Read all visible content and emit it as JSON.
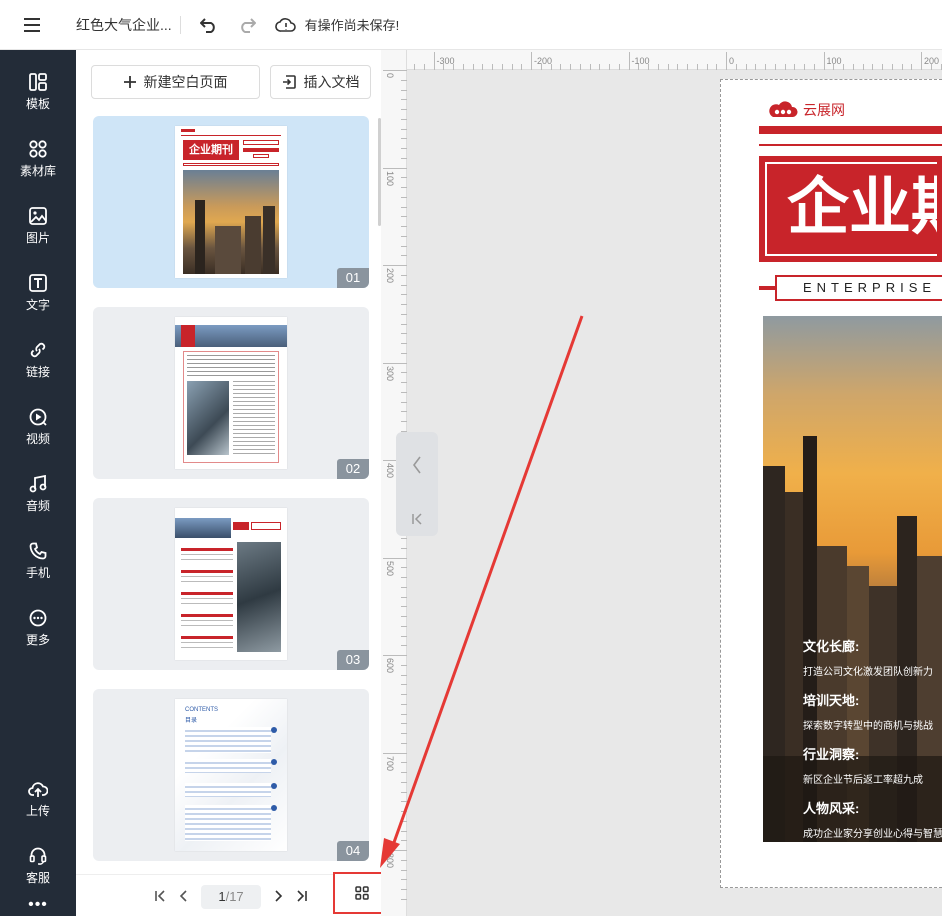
{
  "topbar": {
    "doc_title": "红色大气企业...",
    "save_status": "有操作尚未保存!"
  },
  "sidebar": {
    "items": [
      {
        "label": "模板",
        "icon": "template-icon"
      },
      {
        "label": "素材库",
        "icon": "material-icon"
      },
      {
        "label": "图片",
        "icon": "image-icon"
      },
      {
        "label": "文字",
        "icon": "text-icon"
      },
      {
        "label": "链接",
        "icon": "link-icon"
      },
      {
        "label": "视频",
        "icon": "video-icon"
      },
      {
        "label": "音频",
        "icon": "audio-icon"
      },
      {
        "label": "手机",
        "icon": "phone-icon"
      },
      {
        "label": "更多",
        "icon": "more-icon"
      }
    ],
    "bottom_items": [
      {
        "label": "上传",
        "icon": "upload-icon"
      },
      {
        "label": "客服",
        "icon": "headset-icon"
      }
    ],
    "overflow": "•••"
  },
  "pages_panel": {
    "new_page_label": "新建空白页面",
    "insert_doc_label": "插入文档",
    "thumbnails": [
      {
        "number": "01",
        "active": true
      },
      {
        "number": "02",
        "active": false
      },
      {
        "number": "03",
        "active": false
      },
      {
        "number": "04",
        "active": false
      }
    ]
  },
  "pager": {
    "current": "1",
    "total": "/17"
  },
  "ruler": {
    "h_labels": [
      "-300",
      "-200",
      "-100",
      "0",
      "100",
      "200"
    ],
    "v_labels": [
      "0",
      "100",
      "200",
      "300",
      "400",
      "500",
      "600",
      "700",
      "800"
    ]
  },
  "canvas": {
    "brand": "云展网",
    "title": "企业期刊",
    "subtitle": "ENTERPRISE J",
    "sections": [
      {
        "heading": "文化长廊:",
        "text": "打造公司文化激发团队创新力"
      },
      {
        "heading": "培训天地:",
        "text": "探索数字转型中的商机与挑战"
      },
      {
        "heading": "行业洞察:",
        "text": "新区企业节后返工率超九成"
      },
      {
        "heading": "人物风采:",
        "text": "成功企业家分享创业心得与智慧"
      }
    ]
  },
  "thumb1": {
    "title": "企业期刊"
  },
  "thumb4": {
    "contents": "CONTENTS",
    "contents_cn": "目录"
  },
  "colors": {
    "brand_red": "#c8242a",
    "sidebar_bg": "#232c38",
    "active_thumb": "#cfe5f7",
    "annotation_red": "#e53935"
  }
}
